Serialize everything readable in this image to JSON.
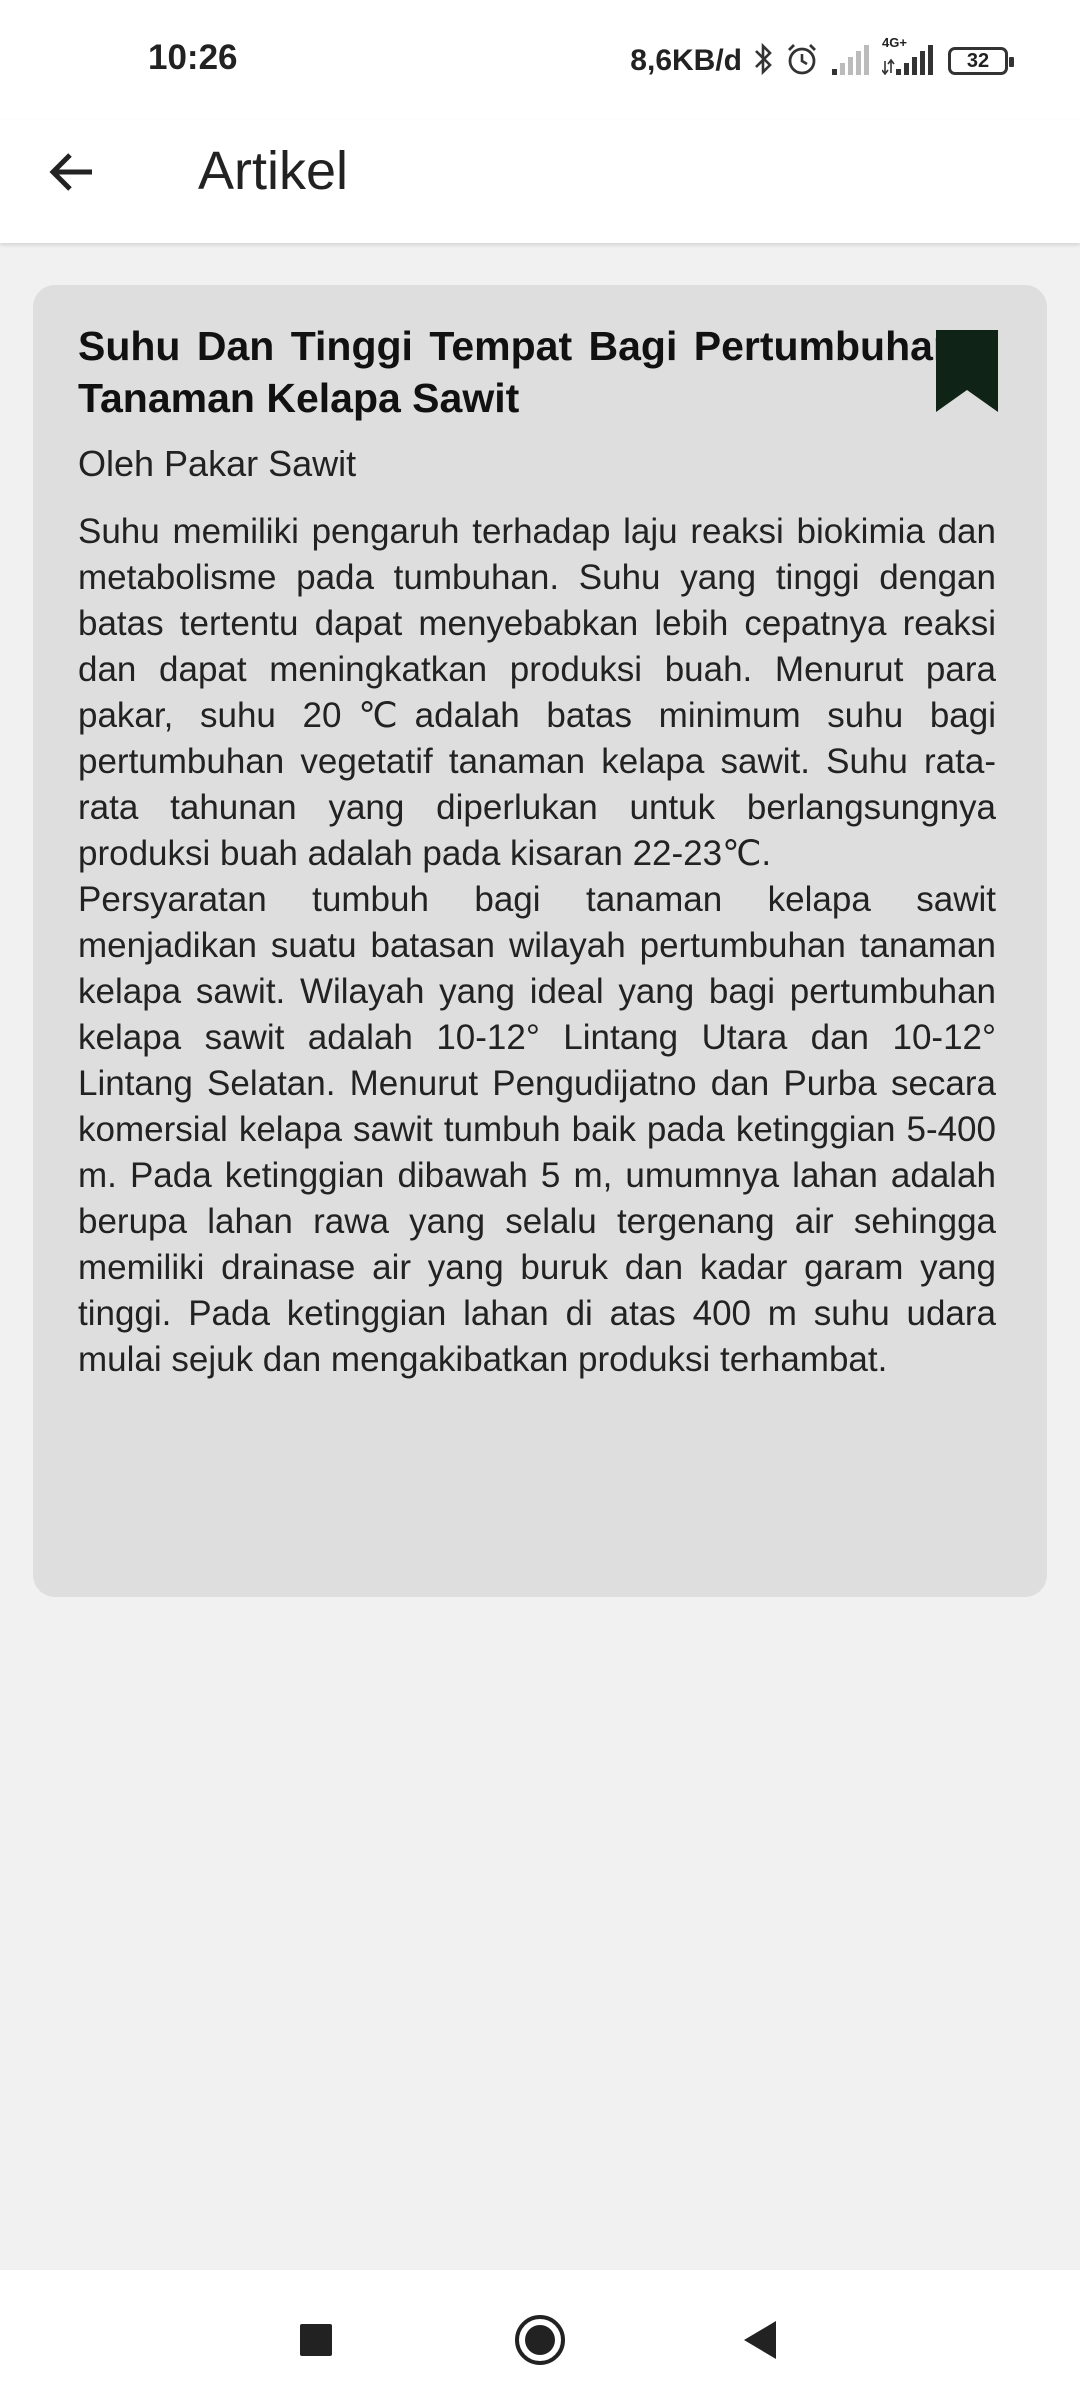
{
  "status_bar": {
    "time": "10:26",
    "network_speed": "8,6KB/d",
    "network_type": "4G+",
    "battery_level": "32",
    "icons": [
      "bluetooth-icon",
      "alarm-icon",
      "signal-icon",
      "signal-4g-icon",
      "battery-icon"
    ]
  },
  "app_bar": {
    "title": "Artikel",
    "back_icon": "arrow-left-icon"
  },
  "article": {
    "title": "Suhu Dan Tinggi Tempat Bagi Pertumbuhan Tanaman Kelapa Sawit",
    "author": "Oleh Pakar Sawit",
    "bookmark_icon": "bookmark-icon",
    "bookmark_color": "#0f2416",
    "paragraphs": [
      "Suhu memiliki pengaruh terhadap laju reaksi biokimia dan metabolisme pada tumbuhan. Suhu yang tinggi dengan batas tertentu dapat menyebabkan lebih cepatnya reaksi dan dapat meningkatkan produksi buah. Menurut para pakar, suhu 20℃adalah batas minimum suhu bagi pertumbuhan vegetatif tanaman kelapa sawit. Suhu rata-rata tahunan yang diperlukan untuk berlangsungnya produksi buah adalah pada kisaran 22-23℃.",
      "Persyaratan tumbuh bagi tanaman kelapa sawit menjadikan suatu batasan wilayah pertumbuhan tanaman kelapa sawit. Wilayah yang ideal yang bagi pertumbuhan kelapa sawit adalah 10-12° Lintang Utara dan  10-12° Lintang Selatan. Menurut Pengudijatno dan Purba secara komersial kelapa sawit tumbuh baik pada ketinggian 5-400 m. Pada ketinggian dibawah 5 m, umumnya lahan adalah berupa lahan rawa yang selalu tergenang air sehingga memiliki drainase air yang buruk dan kadar garam yang tinggi. Pada ketinggian lahan di atas 400 m suhu udara mulai sejuk dan mengakibatkan produksi terhambat."
    ]
  },
  "nav_bar": {
    "icons": [
      "recents-square-icon",
      "home-circle-icon",
      "back-triangle-icon"
    ]
  }
}
